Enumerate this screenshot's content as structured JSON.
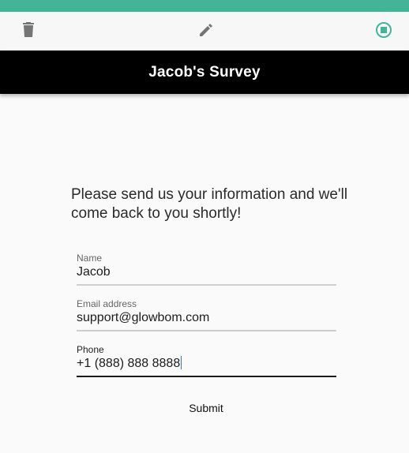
{
  "colors": {
    "top_bar": "#43b497",
    "toolbar_bg": "#f7f7f7",
    "header_bg": "#000000",
    "header_text": "#ffffff",
    "icon_gray": "#757575",
    "icon_accent": "#43b497"
  },
  "toolbar": {
    "icons": [
      "trash-icon",
      "pencil-icon",
      "stop-circle-icon"
    ]
  },
  "header": {
    "title": "Jacob's Survey"
  },
  "form": {
    "prompt": "Please send us your information and we'll come back to you shortly!",
    "fields": [
      {
        "label": "Name",
        "value": "Jacob"
      },
      {
        "label": "Email address",
        "value": "support@glowbom.com"
      },
      {
        "label": "Phone",
        "value": "+1 (888) 888 8888"
      }
    ],
    "submit_label": "Submit"
  }
}
